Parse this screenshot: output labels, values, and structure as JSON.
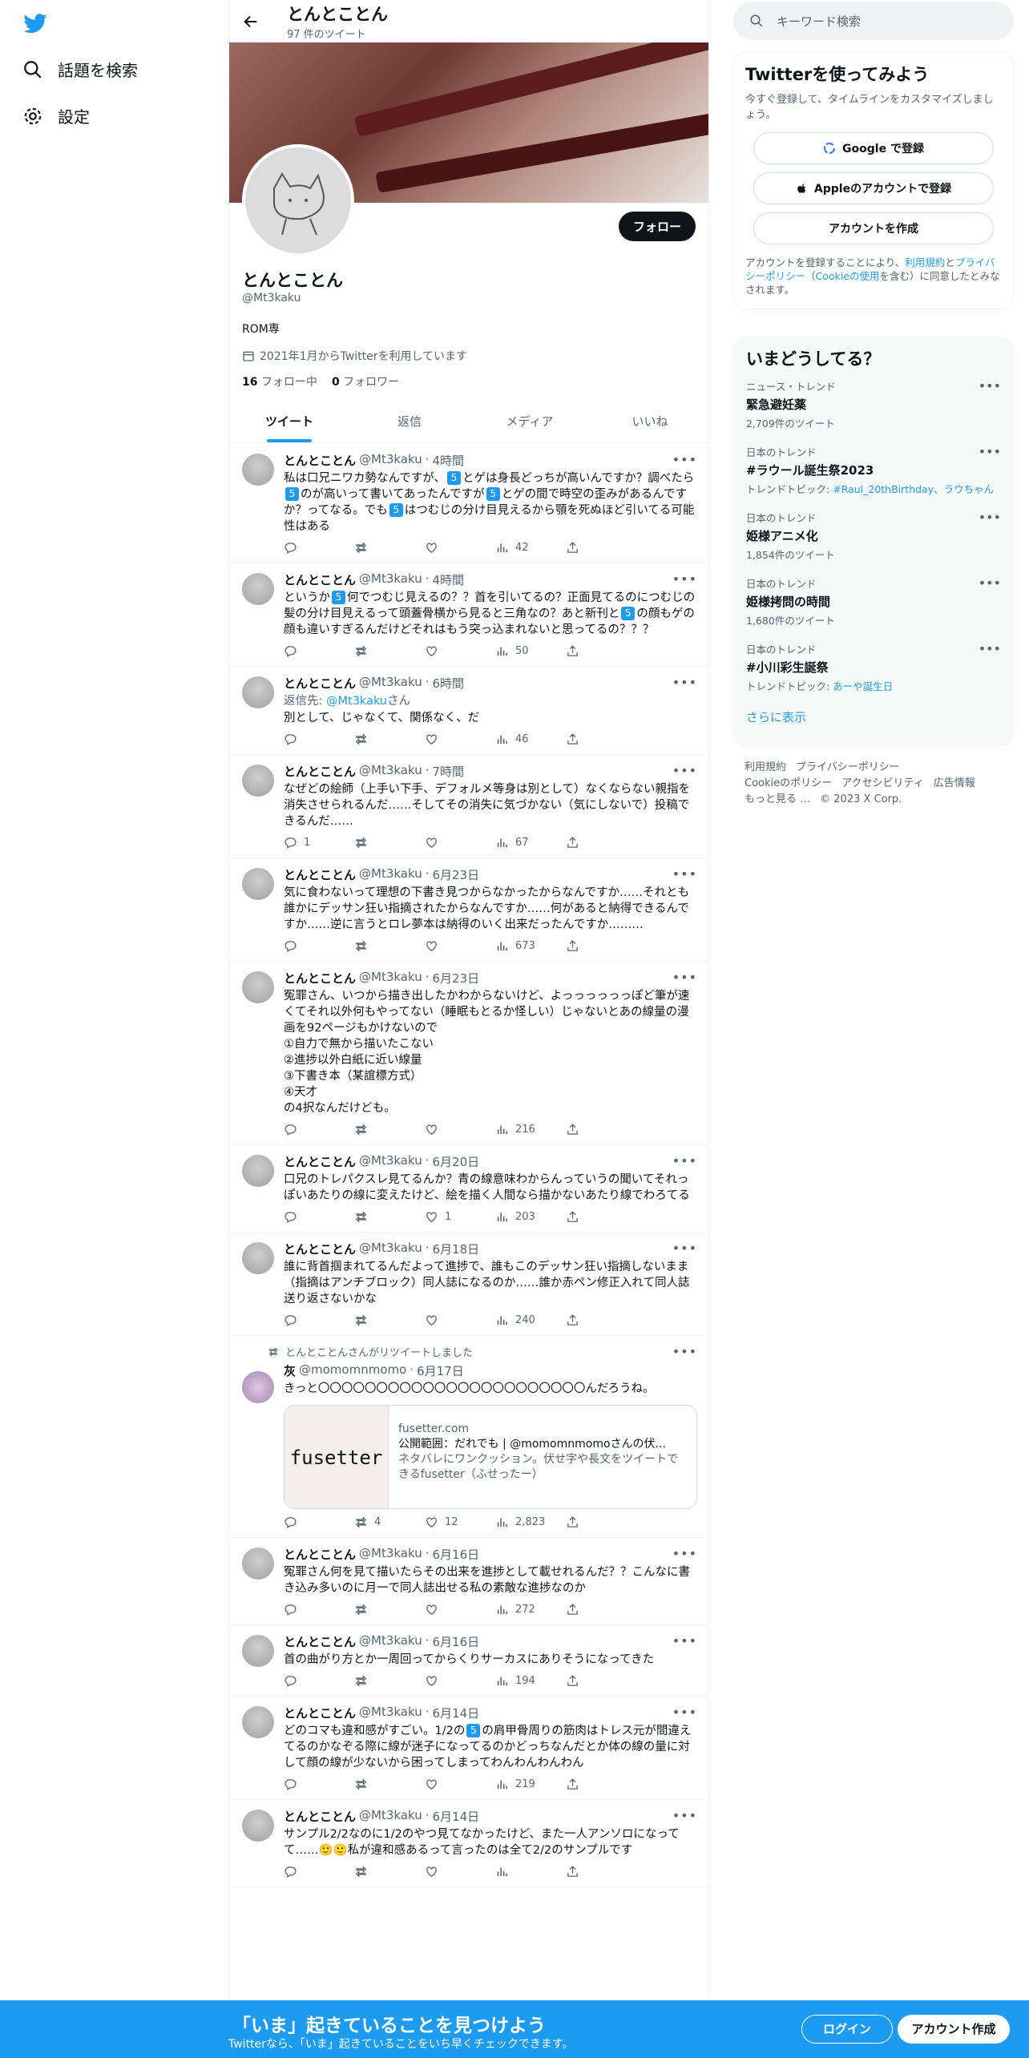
{
  "nav": {
    "search": "話題を検索",
    "settings": "設定"
  },
  "profile": {
    "topbar_name": "とんとことん",
    "tweet_count": "97 件のツイート",
    "name": "とんとことん",
    "handle": "@Mt3kaku",
    "bio": "ROM専",
    "joined": "2021年1月からTwitterを利用しています",
    "following_count": "16",
    "following_label": "フォロー中",
    "followers_count": "0",
    "followers_label": "フォロワー",
    "follow_button": "フォロー"
  },
  "tabs": [
    "ツイート",
    "返信",
    "メディア",
    "いいね"
  ],
  "tweets": [
    {
      "name": "とんとことん",
      "handle": "@Mt3kaku",
      "time": "4時間",
      "text": "私は口兄ニワカ勢なんですが、⑤とゲは身長どっちが高いんですか？調べたら⑤のが高いって書いてあったんですが⑤とゲの間で時空の歪みがあるんですか？ってなる。でも⑤はつむじの分け目見えるから顎を死ぬほど引いてる可能性はある",
      "replies": "",
      "retweets": "",
      "likes": "",
      "views": "42"
    },
    {
      "name": "とんとことん",
      "handle": "@Mt3kaku",
      "time": "4時間",
      "text": "というか⑤何でつむじ見えるの？？首を引いてるの？正面見てるのにつむじの髪の分け目見えるって頭蓋骨横から見ると三角なの？あと新刊と⑤の顔もゲの顔も違いすぎるんだけどそれはもう突っ込まれないと思ってるの？？？",
      "replies": "",
      "retweets": "",
      "likes": "",
      "views": "50"
    },
    {
      "name": "とんとことん",
      "handle": "@Mt3kaku",
      "time": "6時間",
      "reply_to": "返信先: ",
      "reply_handle": "@Mt3kaku",
      "reply_suffix": "さん",
      "text": "別として、じゃなくて、関係なく、だ",
      "replies": "",
      "retweets": "",
      "likes": "",
      "views": "46"
    },
    {
      "name": "とんとことん",
      "handle": "@Mt3kaku",
      "time": "7時間",
      "text": "なぜどの絵師（上手い下手、デフォルメ等身は別として）なくならない親指を消失させられるんだ……そしてその消失に気づかない（気にしないで）投稿できるんだ……",
      "replies": "1",
      "retweets": "",
      "likes": "",
      "views": "67"
    },
    {
      "name": "とんとことん",
      "handle": "@Mt3kaku",
      "time": "6月23日",
      "text": "気に食わないって理想の下書き見つからなかったからなんですか……それとも誰かにデッサン狂い指摘されたからなんですか……何があると納得できるんですか……逆に言うとロレ夢本は納得のいく出来だったんですか………",
      "replies": "",
      "retweets": "",
      "likes": "",
      "views": "673"
    },
    {
      "name": "とんとことん",
      "handle": "@Mt3kaku",
      "time": "6月23日",
      "text": "冤罪さん、いつから描き出したかわからないけど、よっっっっっっぽど筆が速くてそれ以外何もやってない（睡眠もとるか怪しい）じゃないとあの線量の漫画を92ページもかけないので\n①自力で無から描いたこない\n②進捗以外白紙に近い線量\n③下書き本（某誼標方式）\n④天才\nの4択なんだけども。",
      "replies": "",
      "retweets": "",
      "likes": "",
      "views": "216"
    },
    {
      "name": "とんとことん",
      "handle": "@Mt3kaku",
      "time": "6月20日",
      "text": "口兄のトレパクスレ見てるんか？青の線意味わからんっていうの聞いてそれっぽいあたりの線に変えたけど、絵を描く人間なら描かないあたり線でわろてる",
      "replies": "",
      "retweets": "",
      "likes": "1",
      "views": "203"
    },
    {
      "name": "とんとことん",
      "handle": "@Mt3kaku",
      "time": "6月18日",
      "text": "誰に背首掴まれてるんだよって進捗で、誰もこのデッサン狂い指摘しないまま（指摘はアンチブロック）同人誌になるのか……誰か赤ペン修正入れて同人誌送り返さないかな",
      "replies": "",
      "retweets": "",
      "likes": "",
      "views": "240"
    },
    {
      "retweeted_by": "とんとことんさんがリツイートしました",
      "name": "灰",
      "handle": "@momomnmomo",
      "time": "6月17日",
      "text": "きっと〇〇〇〇〇〇〇〇〇〇〇〇〇〇〇〇〇〇〇〇〇〇〇んだろうね。",
      "card": {
        "domain": "fusetter.com",
        "title": "公開範囲：だれでも | @momomnmomoさんの伏...",
        "desc": "ネタバレにワンクッション。伏せ字や長文をツイートできるfusetter（ふせったー）",
        "img_text": "fusetter"
      },
      "replies": "",
      "retweets": "4",
      "likes": "12",
      "views": "2,823"
    },
    {
      "name": "とんとことん",
      "handle": "@Mt3kaku",
      "time": "6月16日",
      "text": "冤罪さん何を見て描いたらその出来を進捗として載せれるんだ？？こんなに書き込み多いのに月一で同人誌出せる私の素敵な進捗なのか",
      "replies": "",
      "retweets": "",
      "likes": "",
      "views": "272"
    },
    {
      "name": "とんとことん",
      "handle": "@Mt3kaku",
      "time": "6月16日",
      "text": "首の曲がり方とか一周回ってからくりサーカスにありそうになってきた",
      "replies": "",
      "retweets": "",
      "likes": "",
      "views": "194"
    },
    {
      "name": "とんとことん",
      "handle": "@Mt3kaku",
      "time": "6月14日",
      "text": "どのコマも違和感がすごい。1/2の⑤の肩甲骨周りの筋肉はトレス元が間違えてるのかなぞる際に線が迷子になってるのかどっちなんだとか体の線の量に対して顔の線が少ないから困ってしまってわんわんわんわん",
      "replies": "",
      "retweets": "",
      "likes": "",
      "views": "219"
    },
    {
      "name": "とんとことん",
      "handle": "@Mt3kaku",
      "time": "6月14日",
      "text": "サンプル2/2なのに1/2のやつ見てなかったけど、また一人アンソロになってて……🙂🙂私が違和感あるって言ったのは全て2/2のサンプルです",
      "replies": "",
      "retweets": "",
      "likes": "",
      "views": ""
    }
  ],
  "sidebar": {
    "search_placeholder": "キーワード検索",
    "signup_title": "Twitterを使ってみよう",
    "signup_sub": "今すぐ登録して、タイムラインをカスタマイズしましょう。",
    "google_button": "Google で登録",
    "apple_button": "Appleのアカウントで登録",
    "create_button": "アカウントを作成",
    "legal_pre": "アカウントを登録することにより、",
    "legal_terms": "利用規約",
    "legal_and": "と",
    "legal_privacy": "プライバシーポリシー",
    "legal_cookie_pre": "（",
    "legal_cookie": "Cookieの使用",
    "legal_post": "を含む）に同意したとみなされます。",
    "trends_title": "いまどうしてる？",
    "trends": [
      {
        "category": "ニュース・トレンド",
        "name": "緊急避妊薬",
        "count": "2,709件のツイート",
        "topic": ""
      },
      {
        "category": "日本のトレンド",
        "name": "#ラウール誕生祭2023",
        "count": "トレンドトピック: ",
        "topic": "#Raul_20thBirthday、ラウちゃん"
      },
      {
        "category": "日本のトレンド",
        "name": "姫様アニメ化",
        "count": "1,854件のツイート",
        "topic": ""
      },
      {
        "category": "日本のトレンド",
        "name": "姫様拷問の時間",
        "count": "1,680件のツイート",
        "topic": ""
      },
      {
        "category": "日本のトレンド",
        "name": "#小川彩生誕祭",
        "count": "トレンドトピック: ",
        "topic": "あーや誕生日"
      }
    ],
    "show_more": "さらに表示",
    "footer": [
      "利用規約",
      "プライバシーポリシー",
      "Cookieのポリシー",
      "アクセシビリティ",
      "広告情報",
      "もっと見る …",
      "© 2023 X Corp."
    ]
  },
  "bottom_bar": {
    "title": "「いま」起きていることを見つけよう",
    "subtitle": "Twitterなら、「いま」起きていることをいち早くチェックできます。",
    "login": "ログイン",
    "signup": "アカウント作成"
  },
  "colors": {
    "accent": "#1d9bf0",
    "text": "#0f1419",
    "muted": "#536471"
  }
}
